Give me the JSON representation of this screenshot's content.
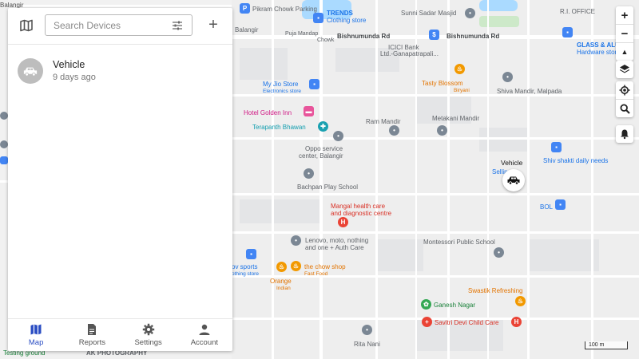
{
  "search": {
    "placeholder": "Search Devices"
  },
  "device": {
    "name": "Vehicle",
    "last_seen": "9 days ago"
  },
  "nav": [
    {
      "label": "Map",
      "icon": "map-icon",
      "active": true
    },
    {
      "label": "Reports",
      "icon": "description-icon"
    },
    {
      "label": "Settings",
      "icon": "gear-icon"
    },
    {
      "label": "Account",
      "icon": "person-icon"
    }
  ],
  "map": {
    "vehicle_label": "Vehicle",
    "scale_label": "100 m",
    "labels": {
      "balangir_top_left": "Balangir",
      "pikram_chowk": "Pikram Chowk Parking",
      "trends": "TRENDS",
      "trends_sub": "Clothing store",
      "sunni_masjid": "Sunni Sadar Masjid",
      "ri_office": "R.I. OFFICE",
      "balangir_2": "Balangir",
      "puja_mandap": "Puja Mandap",
      "chowk": "Chowk",
      "bishnumunda_1": "Bishnumunda Rd",
      "bishnumunda_2": "Bishnumunda Rd",
      "icici": "ICICI Bank",
      "icici_sub": "Ltd.-Ganapatrapali...",
      "glass_aluminium": "GLASS & ALUMIN",
      "glass_sub": "Hardware store",
      "my_jio": "My Jio Store",
      "my_jio_sub": "Electronics store",
      "tasty_blossom": "Tasty Blossom",
      "tasty_sub": "Biryani",
      "shiva_mandir": "Shiva Mandir, Malpada",
      "hotel_golden": "Hotel Golden Inn",
      "terapanth": "Terapanth Bhawan",
      "ram_mandir": "Ram Mandir",
      "metakani": "Metakani Mandir",
      "oppo_1": "Oppo service",
      "oppo_2": "center, Balangir",
      "selling": "Selling",
      "shiv_shakti": "Shiv shakti daily needs",
      "bachpan": "Bachpan Play School",
      "mangal_1": "Mangal health care",
      "mangal_2": "and diagnostic centre",
      "bol": "BOL",
      "lenovo_1": "Lenovo, moto, nothing",
      "lenovo_2": "and one + Auth Care",
      "montessori": "Montessori Public School",
      "ov_sports": "ov sports",
      "ov_sub": "othing store",
      "chow_shop": "the chow shop",
      "chow_sub": "Fast Food",
      "orange": "Orange",
      "orange_sub": "Indian",
      "swastik": "Swastik Refreshing",
      "ganesh": "Ganesh Nagar",
      "savitri": "Savitri Devi Child Care",
      "rita_nani": "Rita Nani",
      "testing_ground": "Testing ground",
      "ak_photo": "AK PHOTOGRAPHY",
      "ak_photo_sub": "BALANGIR"
    }
  },
  "colors": {
    "nav_active": "#2a4dc3",
    "water": "#aadaff",
    "park": "#cde9c9",
    "poi_orange": "#f29900",
    "poi_red": "#ea4335"
  }
}
